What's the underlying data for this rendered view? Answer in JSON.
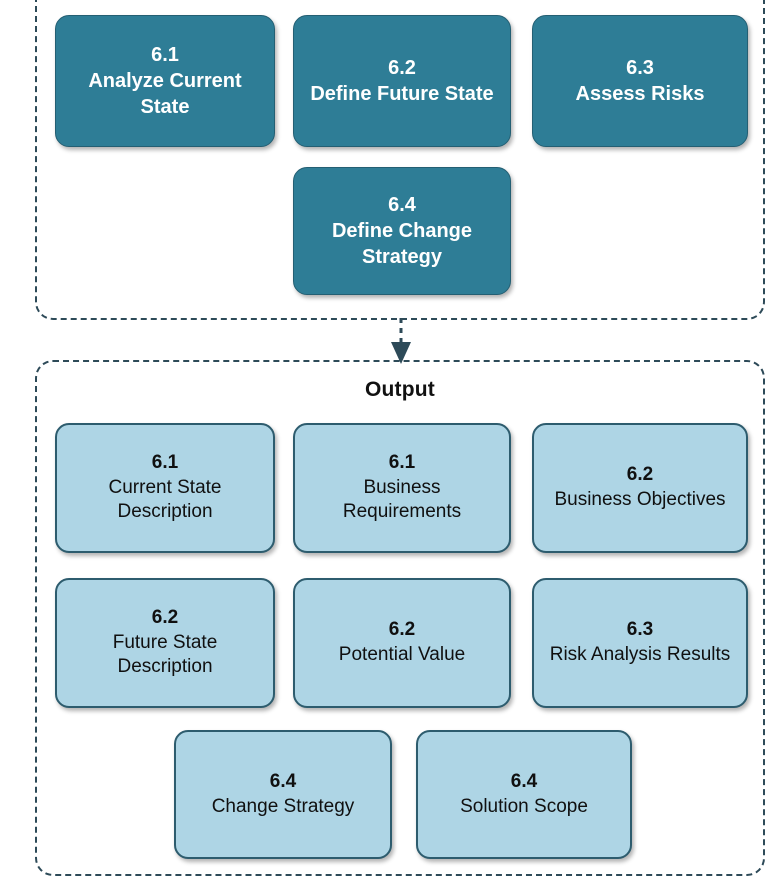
{
  "diagram": {
    "colors": {
      "process_fill": "#2e7d96",
      "process_border": "#245f73",
      "process_text": "#ffffff",
      "output_fill": "#aed5e5",
      "output_border": "#2d5c6e",
      "output_text": "#101010",
      "group_border": "#2d4a58",
      "arrow": "#2d4a58",
      "background": "#ffffff"
    },
    "process_group": {
      "nodes": [
        {
          "num": "6.1",
          "label": "Analyze Current State"
        },
        {
          "num": "6.2",
          "label": "Define Future State"
        },
        {
          "num": "6.3",
          "label": "Assess Risks"
        },
        {
          "num": "6.4",
          "label": "Define Change Strategy"
        }
      ]
    },
    "connector": {
      "icon": "down-arrow-icon",
      "style": "dashed"
    },
    "output_group": {
      "title": "Output",
      "nodes": [
        {
          "num": "6.1",
          "label": "Current State Description"
        },
        {
          "num": "6.1",
          "label": "Business Requirements"
        },
        {
          "num": "6.2",
          "label": "Business Objectives"
        },
        {
          "num": "6.2",
          "label": "Future State Description"
        },
        {
          "num": "6.2",
          "label": "Potential Value"
        },
        {
          "num": "6.3",
          "label": "Risk Analysis Results"
        },
        {
          "num": "6.4",
          "label": "Change Strategy"
        },
        {
          "num": "6.4",
          "label": "Solution Scope"
        }
      ]
    }
  }
}
